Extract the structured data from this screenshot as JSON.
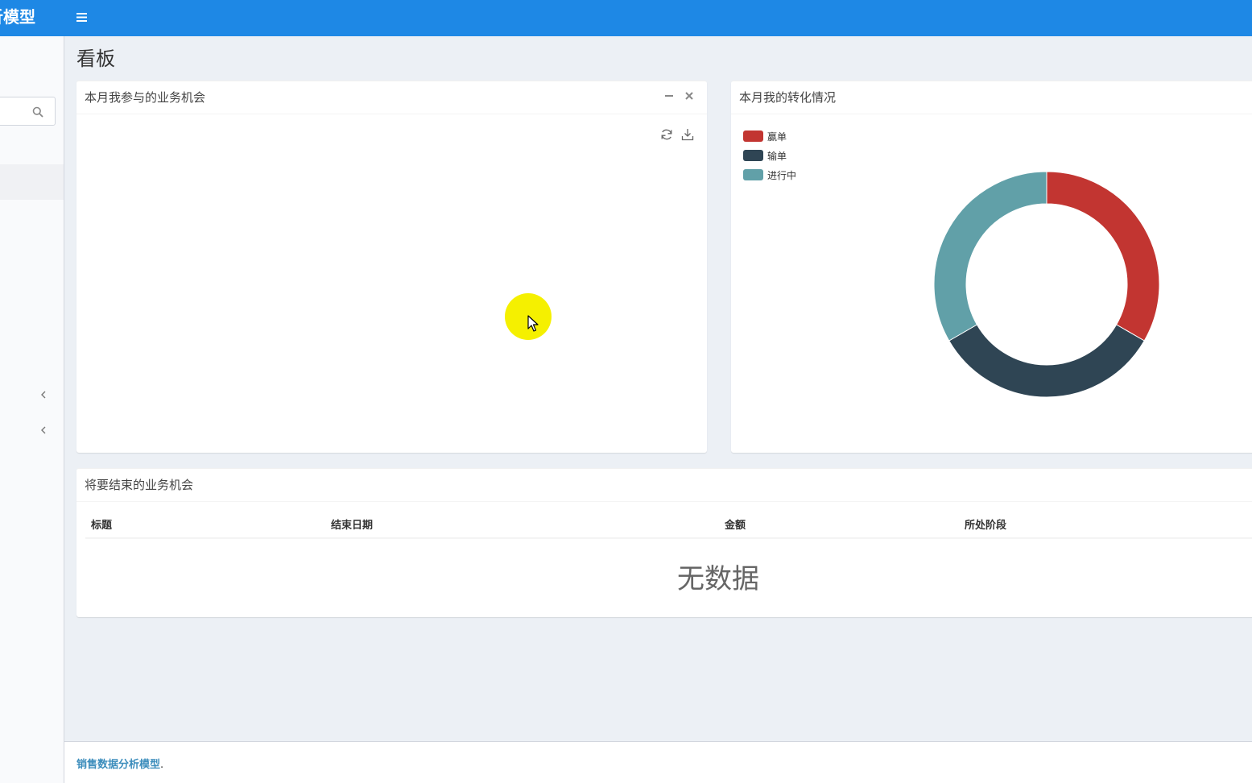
{
  "header": {
    "brand": "销售数据分析模型",
    "menu_icon": "hamburger-icon"
  },
  "sidebar": {
    "search_icon": "search-icon",
    "chevron_icon": "chevron-left-icon"
  },
  "page": {
    "title": "看板"
  },
  "panels": {
    "my_opportunities": {
      "title": "本月我参与的业务机会",
      "collapse_icon": "minus-icon",
      "close_icon": "close-icon",
      "refresh_icon": "refresh-icon",
      "download_icon": "download-icon"
    },
    "conversion": {
      "title": "本月我的转化情况"
    },
    "ending": {
      "title": "将要结束的业务机会",
      "columns": [
        "标题",
        "结束日期",
        "金额",
        "所处阶段"
      ],
      "empty_text": "无数据"
    }
  },
  "chart_data": {
    "type": "pie",
    "categories": [
      "赢单",
      "输单",
      "进行中"
    ],
    "values": [
      1,
      1,
      1
    ],
    "colors": [
      "#c23531",
      "#2f4554",
      "#61a0a8"
    ],
    "legend": "top-left",
    "donut": true
  },
  "footer": {
    "brand_link": "销售数据分析模型",
    "suffix": "."
  },
  "colors": {
    "topbar": "#1e88e5",
    "link": "#3c8dbc",
    "cursor_highlight": "#f5f000"
  }
}
